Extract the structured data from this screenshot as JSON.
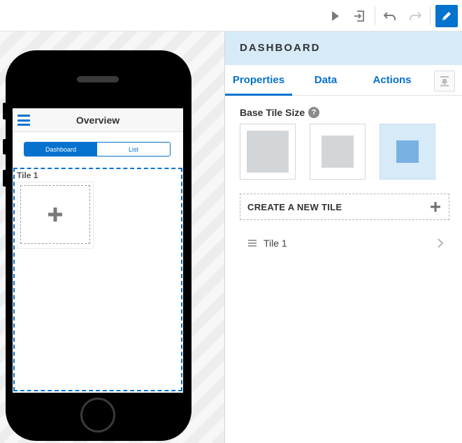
{
  "toolbar": {
    "icons": [
      "play-icon",
      "exit-preview-icon",
      "undo-icon",
      "redo-icon",
      "pencil-icon"
    ]
  },
  "phone": {
    "app_title": "Overview",
    "segments": [
      "Dashboard",
      "List"
    ],
    "active_segment": "Dashboard",
    "tile_label": "Tile 1"
  },
  "panel": {
    "title": "DASHBOARD",
    "tabs": [
      {
        "label": "Properties",
        "active": true
      },
      {
        "label": "Data",
        "active": false
      },
      {
        "label": "Actions",
        "active": false
      }
    ],
    "base_tile_size_label": "Base Tile Size",
    "help_glyph": "?",
    "tile_sizes": [
      {
        "name": "large",
        "selected": false
      },
      {
        "name": "medium",
        "selected": false
      },
      {
        "name": "small",
        "selected": true
      }
    ],
    "create_tile_label": "CREATE A NEW TILE",
    "tiles": [
      {
        "label": "Tile 1"
      }
    ]
  },
  "colors": {
    "accent": "#0572ce",
    "header_bg": "#d6eaf8",
    "selected_tile_bg": "#d6eaf8",
    "small_tile_fill": "#79b1e3"
  }
}
